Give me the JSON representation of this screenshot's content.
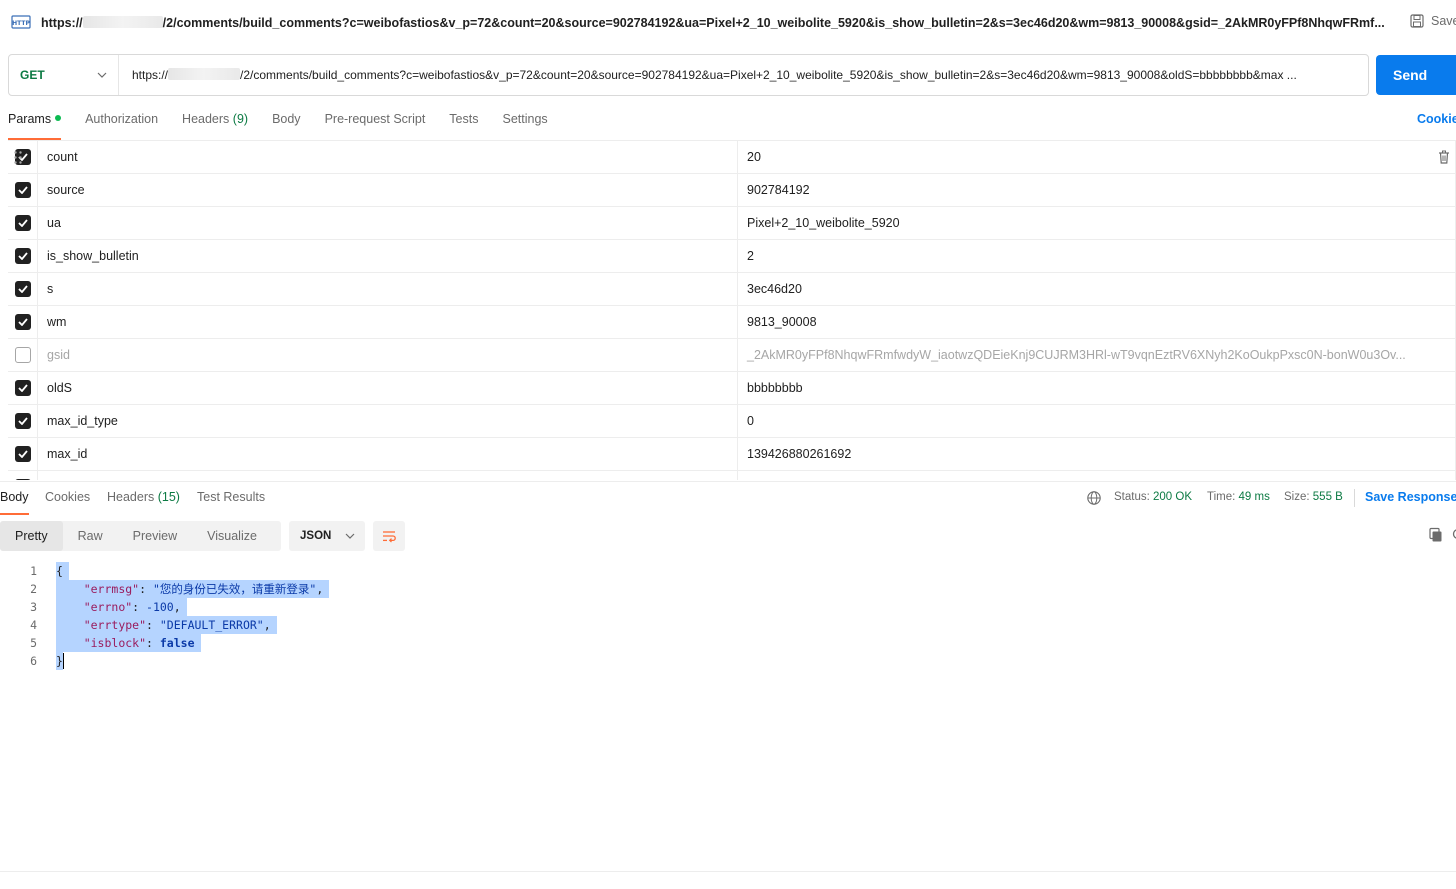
{
  "title": {
    "url_prefix": "https://",
    "url_rest": "/2/comments/build_comments?c=weibofastios&v_p=72&count=20&source=902784192&ua=Pixel+2_10_weibolite_5920&is_show_bulletin=2&s=3ec46d20&wm=9813_90008&gsid=_2AkMR0yFPf8NhqwFRmf...",
    "save_label": "Save"
  },
  "request": {
    "method": "GET",
    "url_prefix": "https://",
    "url_rest": "/2/comments/build_comments?c=weibofastios&v_p=72&count=20&source=902784192&ua=Pixel+2_10_weibolite_5920&is_show_bulletin=2&s=3ec46d20&wm=9813_90008&oldS=bbbbbbbb&max ...",
    "send_label": "Send"
  },
  "req_tabs": {
    "params": "Params",
    "authorization": "Authorization",
    "headers": "Headers",
    "headers_count": "(9)",
    "body": "Body",
    "prerequest": "Pre-request Script",
    "tests": "Tests",
    "settings": "Settings",
    "cookies": "Cookies"
  },
  "params": [
    {
      "key": "count",
      "value": "20",
      "checked": true
    },
    {
      "key": "source",
      "value": "902784192",
      "checked": true
    },
    {
      "key": "ua",
      "value": "Pixel+2_10_weibolite_5920",
      "checked": true
    },
    {
      "key": "is_show_bulletin",
      "value": "2",
      "checked": true
    },
    {
      "key": "s",
      "value": "3ec46d20",
      "checked": true
    },
    {
      "key": "wm",
      "value": "9813_90008",
      "checked": true
    },
    {
      "key": "gsid",
      "value": "_2AkMR0yFPf8NhqwFRmfwdyW_iaotwzQDEieKnj9CUJRM3HRl-wT9vqnEztRV6XNyh2KoOukpPxsc0N-bonW0u3Ov...",
      "checked": false
    },
    {
      "key": "oldS",
      "value": "bbbbbbbb",
      "checked": true
    },
    {
      "key": "max_id_type",
      "value": "0",
      "checked": true
    },
    {
      "key": "max_id",
      "value": "139426880261692",
      "checked": true
    }
  ],
  "resp_tabs": {
    "body": "Body",
    "cookies": "Cookies",
    "headers": "Headers",
    "headers_count": "(15)",
    "test_results": "Test Results"
  },
  "resp_status": {
    "status_label": "Status:",
    "status_value": "200 OK",
    "time_label": "Time:",
    "time_value": "49 ms",
    "size_label": "Size:",
    "size_value": "555 B",
    "save_response": "Save Response"
  },
  "view_modes": {
    "pretty": "Pretty",
    "raw": "Raw",
    "preview": "Preview",
    "visualize": "Visualize",
    "format": "JSON"
  },
  "code": {
    "line_numbers": [
      "1",
      "2",
      "3",
      "4",
      "5",
      "6"
    ],
    "open_brace": "{",
    "close_brace": "}",
    "errmsg_key": "\"errmsg\"",
    "errmsg_val": "\"您的身份已失效，请重新登录\"",
    "errno_key": "\"errno\"",
    "errno_val": "-100",
    "errtype_key": "\"errtype\"",
    "errtype_val": "\"DEFAULT_ERROR\"",
    "isblock_key": "\"isblock\"",
    "isblock_val": "false"
  },
  "colors": {
    "accent": "#ff6c37",
    "send": "#097bed",
    "status_green": "#0c7a43",
    "selection": "#b5d4ff"
  }
}
